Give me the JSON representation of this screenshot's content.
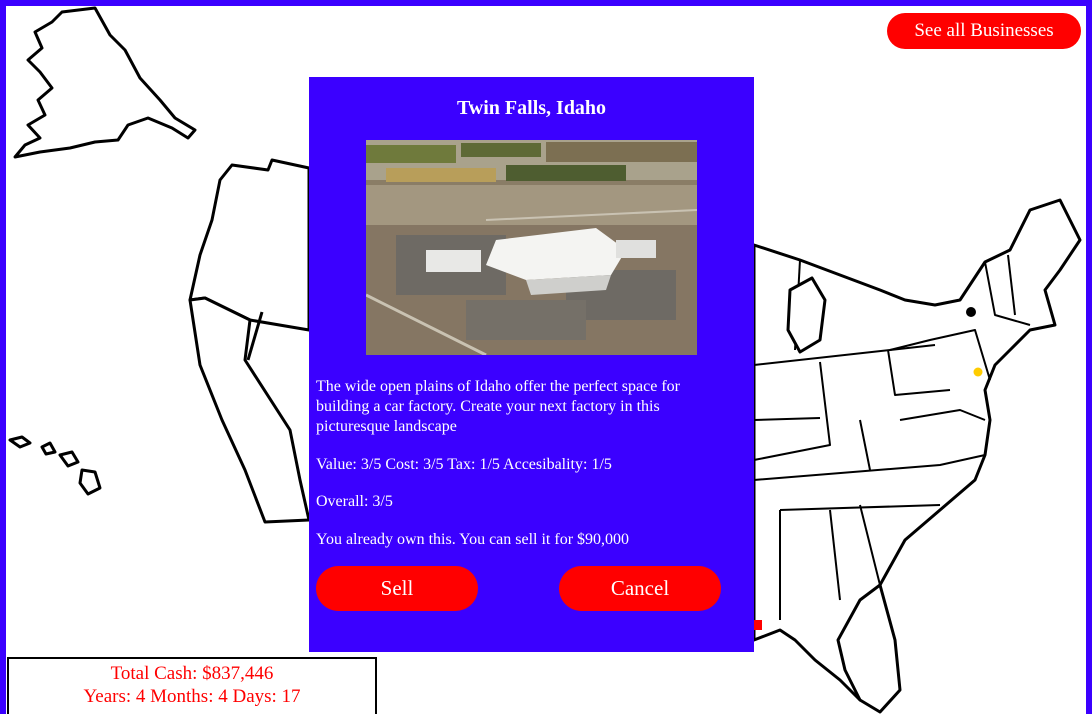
{
  "header": {
    "see_all_label": "See all Businesses"
  },
  "modal": {
    "title": "Twin Falls, Idaho",
    "description": "The wide open plains of Idaho offer the perfect space for building a car factory. Create your next factory in this picturesque landscape",
    "stats": "Value: 3/5 Cost: 3/5 Tax: 1/5 Accesibality: 1/5",
    "overall": "Overall: 3/5",
    "owned_text": "You already own this. You can sell it for $90,000",
    "sell_label": "Sell",
    "cancel_label": "Cancel"
  },
  "status": {
    "cash": "Total Cash: $837,446",
    "time": "Years: 4 Months: 4 Days: 17"
  },
  "colors": {
    "accent": "#3b00ff",
    "button": "#ff0000",
    "marker_owned": "#000000",
    "marker_highlight": "#ffcc00"
  }
}
